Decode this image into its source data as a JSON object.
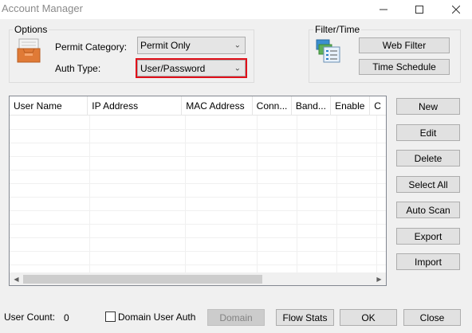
{
  "window": {
    "title": "Account Manager",
    "controls": [
      "minimize-icon",
      "maximize-icon",
      "close-icon"
    ]
  },
  "options": {
    "group_label": "Options",
    "permit_category_label": "Permit Category:",
    "permit_category_value": "Permit Only",
    "auth_type_label": "Auth Type:",
    "auth_type_value": "User/Password"
  },
  "filter_time": {
    "group_label": "Filter/Time",
    "web_filter_label": "Web Filter",
    "time_schedule_label": "Time Schedule"
  },
  "table": {
    "columns": [
      "User Name",
      "IP Address",
      "MAC Address",
      "Conn...",
      "Band...",
      "Enable",
      "C"
    ],
    "rows": []
  },
  "side_buttons": {
    "new": "New",
    "edit": "Edit",
    "delete": "Delete",
    "select_all": "Select All",
    "auto_scan": "Auto Scan",
    "export": "Export",
    "import": "Import"
  },
  "footer": {
    "user_count_label": "User Count:",
    "user_count_value": "0",
    "domain_user_auth_label": "Domain User Auth",
    "domain_label": "Domain",
    "flow_stats_label": "Flow Stats",
    "ok_label": "OK",
    "close_label": "Close"
  },
  "colors": {
    "highlight": "#e0101a",
    "window_bg": "#f0f0f0"
  }
}
